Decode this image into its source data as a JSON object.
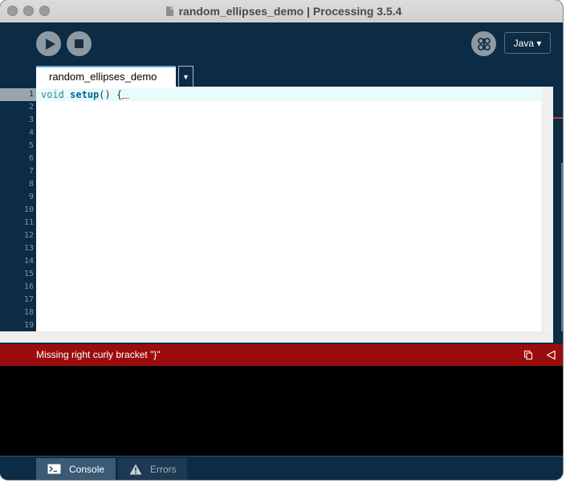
{
  "window": {
    "title": "random_ellipses_demo | Processing 3.5.4"
  },
  "toolbar": {
    "mode_icon": "butterfly-icon",
    "language": "Java ▾"
  },
  "tabs": [
    {
      "label": "random_ellipses_demo"
    }
  ],
  "tab_menu_glyph": "▼",
  "editor": {
    "code_tokens": {
      "void": "void",
      "setup": "setup",
      "parens": "()",
      "brace": "{"
    },
    "current_line": 1,
    "line_numbers": [
      "1",
      "2",
      "3",
      "4",
      "5",
      "6",
      "7",
      "8",
      "9",
      "10",
      "11",
      "12",
      "13",
      "14",
      "15",
      "16",
      "17",
      "18",
      "19"
    ]
  },
  "status": {
    "message": "Missing right curly bracket \"}\"",
    "color": "#9b0d0d"
  },
  "bottom_tabs": {
    "console": "Console",
    "errors": "Errors"
  },
  "colors": {
    "chrome": "#0c2b45",
    "editor_bg": "#ffffff",
    "error_bar": "#9b0d0d",
    "keyword": "#006699"
  }
}
